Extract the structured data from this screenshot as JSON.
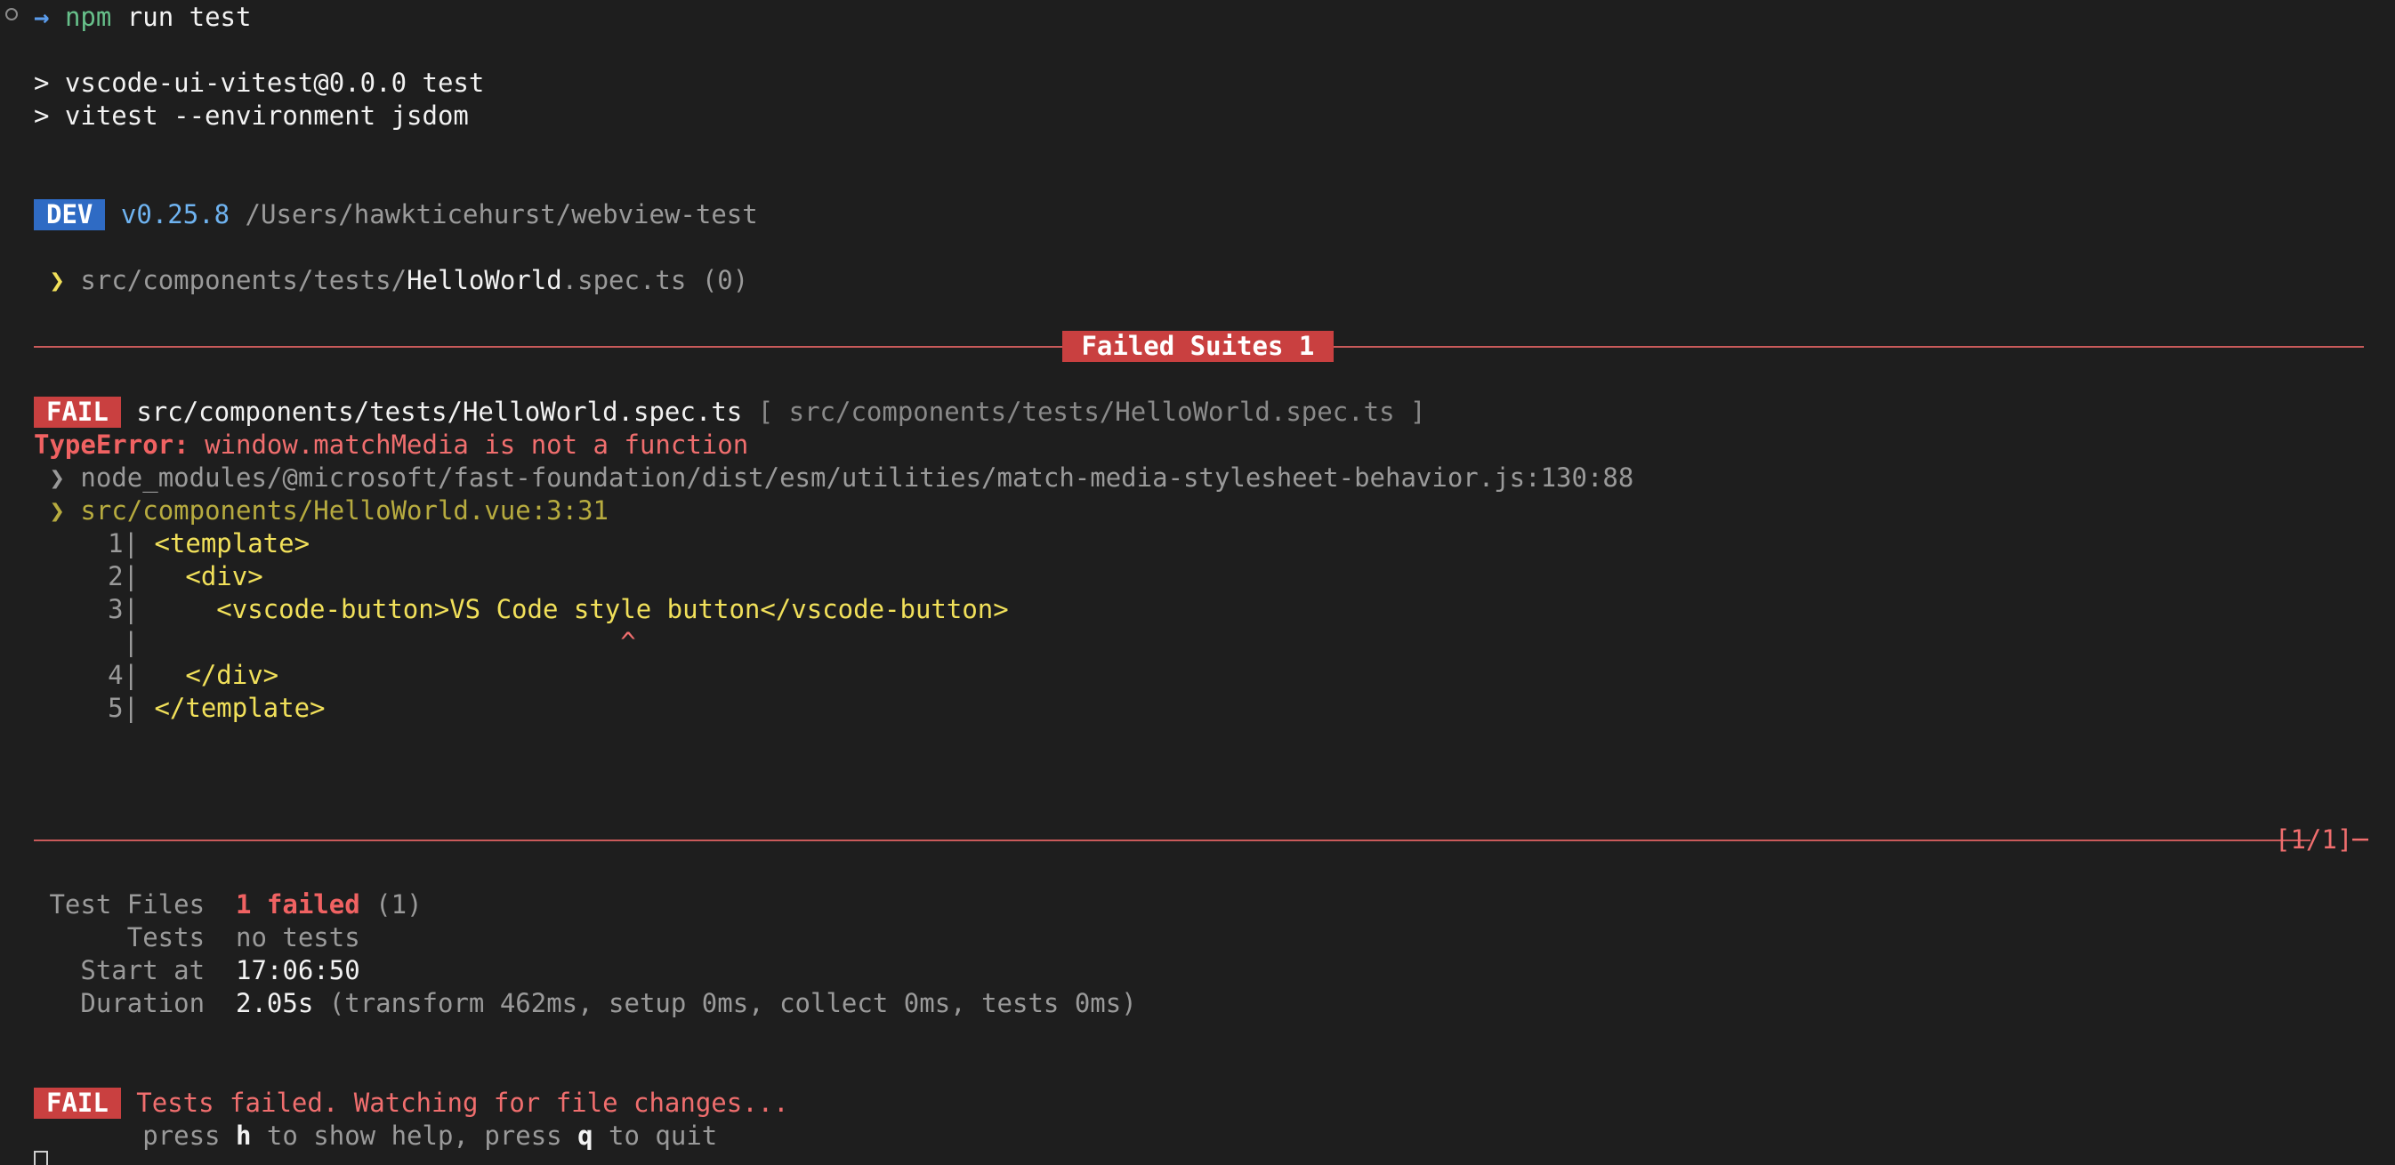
{
  "prompt": {
    "arrow": "→",
    "command": "npm",
    "args": " run test"
  },
  "script_lines": [
    "> vscode-ui-vitest@0.0.0 test",
    "> vitest --environment jsdom"
  ],
  "dev_header": {
    "badge": "DEV",
    "version": "v0.25.8",
    "path": "/Users/hawkticehurst/webview-test"
  },
  "running_file": {
    "marker": "❯",
    "dir": "src/components/tests/",
    "name": "HelloWorld",
    "ext": ".spec.ts",
    "count": " (0)"
  },
  "failed_suites": {
    "label": " Failed Suites 1 "
  },
  "fail_entry": {
    "badge": "FAIL",
    "file": "src/components/tests/HelloWorld.spec.ts",
    "bracket": "[ src/components/tests/HelloWorld.spec.ts ]"
  },
  "error": {
    "type": "TypeError:",
    "message": " window.matchMedia is not a function"
  },
  "stack": [
    {
      "marker": "❯",
      "text": " node_modules/@microsoft/fast-foundation/dist/esm/utilities/match-media-stylesheet-behavior.js:130:88"
    },
    {
      "marker": "❯",
      "text": " src/components/HelloWorld.vue:3:31"
    }
  ],
  "code_frame": [
    {
      "ln": "1|",
      "code": " <template>"
    },
    {
      "ln": "2|",
      "code": "   <div>"
    },
    {
      "ln": "3|",
      "code": "     <vscode-button>VS Code style button</vscode-button>"
    },
    {
      "ln": " |",
      "code": "                               ^"
    },
    {
      "ln": "4|",
      "code": "   </div>"
    },
    {
      "ln": "5|",
      "code": " </template>"
    }
  ],
  "pagination": {
    "label": "[1/1]"
  },
  "summary": {
    "test_files_label": "Test Files",
    "test_files_value": "1 failed",
    "test_files_count": " (1)",
    "tests_label": "Tests",
    "tests_value": "no tests",
    "start_label": "Start at",
    "start_value": "17:06:50",
    "duration_label": "Duration",
    "duration_value": "2.05s",
    "duration_detail": " (transform 462ms, setup 0ms, collect 0ms, tests 0ms)"
  },
  "footer": {
    "badge": "FAIL",
    "message": " Tests failed. Watching for file changes...",
    "help_prefix": "press ",
    "help_key": "h",
    "help_mid": " to show help, press ",
    "quit_key": "q",
    "help_suffix": " to quit"
  },
  "colors": {
    "background": "#1e1e1e",
    "dev_badge": "#2f6bc4",
    "fail_badge": "#c94040",
    "rule": "#c95a5a"
  }
}
